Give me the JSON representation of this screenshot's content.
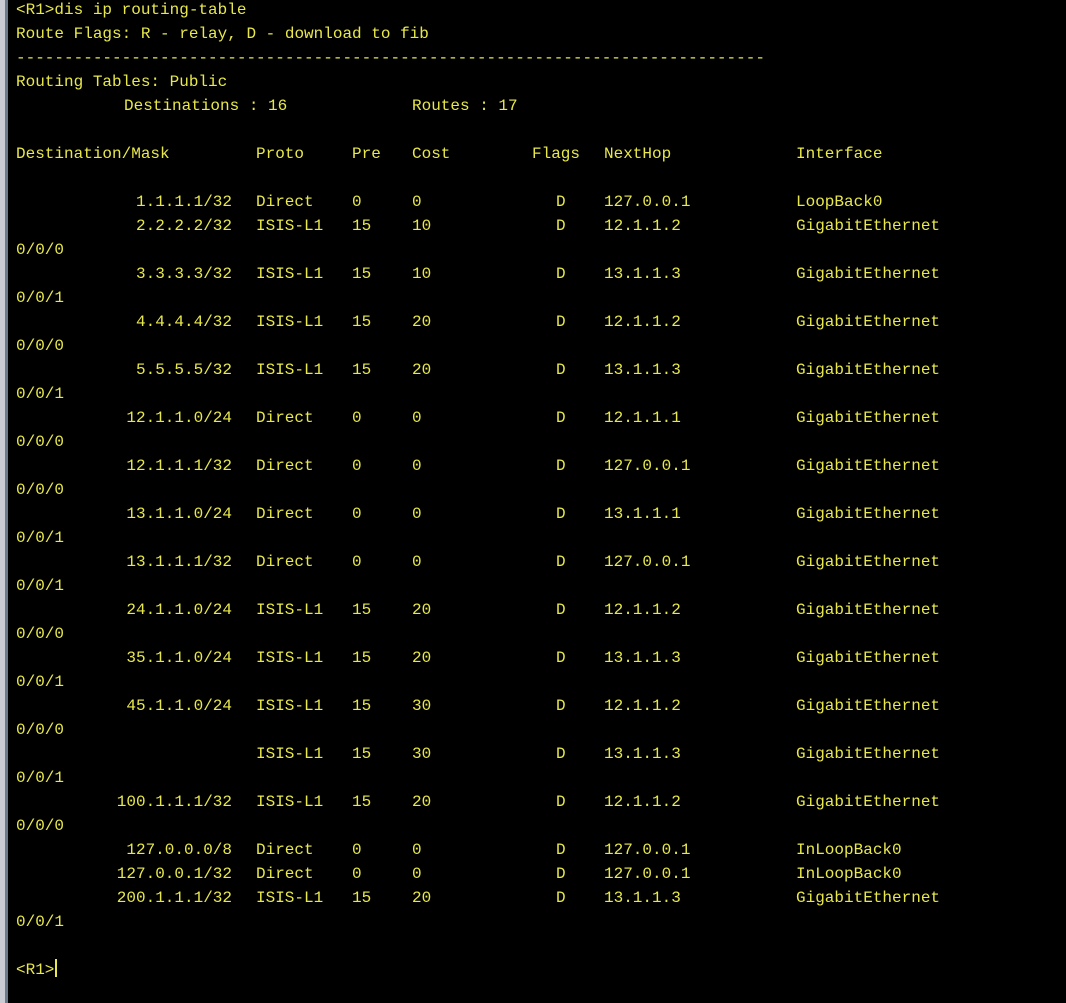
{
  "prompt": "<R1>",
  "command": "dis ip routing-table",
  "flags_legend": "Route Flags: R - relay, D - download to fib",
  "separator": "------------------------------------------------------------------------------",
  "table_title": "Routing Tables: Public",
  "summary": {
    "destinations_label": "Destinations : 16",
    "routes_label": "Routes : 17"
  },
  "headers": {
    "destination": "Destination/Mask",
    "proto": "Proto",
    "pre": "Pre",
    "cost": "Cost",
    "flags": "Flags",
    "nexthop": "NextHop",
    "interface": "Interface"
  },
  "routes": [
    {
      "dest": "1.1.1.1/32",
      "proto": "Direct",
      "pre": "0",
      "cost": "0",
      "flags": "D",
      "nexthop": "127.0.0.1",
      "iface": "LoopBack0",
      "iface_cont": ""
    },
    {
      "dest": "2.2.2.2/32",
      "proto": "ISIS-L1",
      "pre": "15",
      "cost": "10",
      "flags": "D",
      "nexthop": "12.1.1.2",
      "iface": "GigabitEthernet",
      "iface_cont": "0/0/0"
    },
    {
      "dest": "3.3.3.3/32",
      "proto": "ISIS-L1",
      "pre": "15",
      "cost": "10",
      "flags": "D",
      "nexthop": "13.1.1.3",
      "iface": "GigabitEthernet",
      "iface_cont": "0/0/1"
    },
    {
      "dest": "4.4.4.4/32",
      "proto": "ISIS-L1",
      "pre": "15",
      "cost": "20",
      "flags": "D",
      "nexthop": "12.1.1.2",
      "iface": "GigabitEthernet",
      "iface_cont": "0/0/0"
    },
    {
      "dest": "5.5.5.5/32",
      "proto": "ISIS-L1",
      "pre": "15",
      "cost": "20",
      "flags": "D",
      "nexthop": "13.1.1.3",
      "iface": "GigabitEthernet",
      "iface_cont": "0/0/1"
    },
    {
      "dest": "12.1.1.0/24",
      "proto": "Direct",
      "pre": "0",
      "cost": "0",
      "flags": "D",
      "nexthop": "12.1.1.1",
      "iface": "GigabitEthernet",
      "iface_cont": "0/0/0"
    },
    {
      "dest": "12.1.1.1/32",
      "proto": "Direct",
      "pre": "0",
      "cost": "0",
      "flags": "D",
      "nexthop": "127.0.0.1",
      "iface": "GigabitEthernet",
      "iface_cont": "0/0/0"
    },
    {
      "dest": "13.1.1.0/24",
      "proto": "Direct",
      "pre": "0",
      "cost": "0",
      "flags": "D",
      "nexthop": "13.1.1.1",
      "iface": "GigabitEthernet",
      "iface_cont": "0/0/1"
    },
    {
      "dest": "13.1.1.1/32",
      "proto": "Direct",
      "pre": "0",
      "cost": "0",
      "flags": "D",
      "nexthop": "127.0.0.1",
      "iface": "GigabitEthernet",
      "iface_cont": "0/0/1"
    },
    {
      "dest": "24.1.1.0/24",
      "proto": "ISIS-L1",
      "pre": "15",
      "cost": "20",
      "flags": "D",
      "nexthop": "12.1.1.2",
      "iface": "GigabitEthernet",
      "iface_cont": "0/0/0"
    },
    {
      "dest": "35.1.1.0/24",
      "proto": "ISIS-L1",
      "pre": "15",
      "cost": "20",
      "flags": "D",
      "nexthop": "13.1.1.3",
      "iface": "GigabitEthernet",
      "iface_cont": "0/0/1"
    },
    {
      "dest": "45.1.1.0/24",
      "proto": "ISIS-L1",
      "pre": "15",
      "cost": "30",
      "flags": "D",
      "nexthop": "12.1.1.2",
      "iface": "GigabitEthernet",
      "iface_cont": "0/0/0"
    },
    {
      "dest": "",
      "proto": "ISIS-L1",
      "pre": "15",
      "cost": "30",
      "flags": "D",
      "nexthop": "13.1.1.3",
      "iface": "GigabitEthernet",
      "iface_cont": "0/0/1"
    },
    {
      "dest": "100.1.1.1/32",
      "proto": "ISIS-L1",
      "pre": "15",
      "cost": "20",
      "flags": "D",
      "nexthop": "12.1.1.2",
      "iface": "GigabitEthernet",
      "iface_cont": "0/0/0"
    },
    {
      "dest": "127.0.0.0/8",
      "proto": "Direct",
      "pre": "0",
      "cost": "0",
      "flags": "D",
      "nexthop": "127.0.0.1",
      "iface": "InLoopBack0",
      "iface_cont": ""
    },
    {
      "dest": "127.0.0.1/32",
      "proto": "Direct",
      "pre": "0",
      "cost": "0",
      "flags": "D",
      "nexthop": "127.0.0.1",
      "iface": "InLoopBack0",
      "iface_cont": ""
    },
    {
      "dest": "200.1.1.1/32",
      "proto": "ISIS-L1",
      "pre": "15",
      "cost": "20",
      "flags": "D",
      "nexthop": "13.1.1.3",
      "iface": "GigabitEthernet",
      "iface_cont": "0/0/1"
    }
  ],
  "final_prompt": "<R1>",
  "colors": {
    "background": "#000000",
    "text": "#e8e84c"
  }
}
